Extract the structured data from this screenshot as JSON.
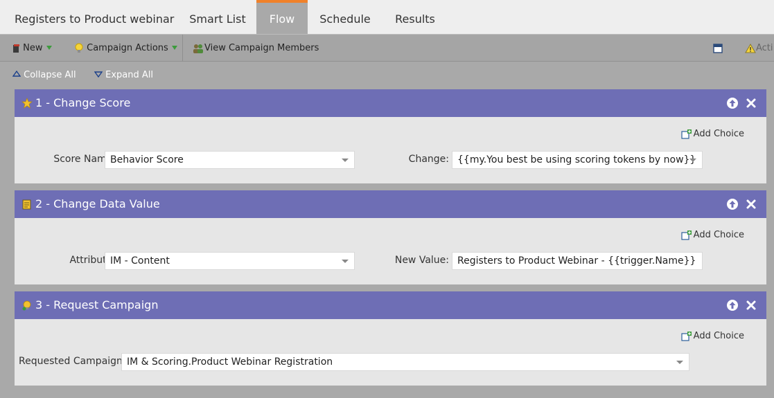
{
  "tabs": [
    {
      "label": "Registers to Product webinar",
      "active": false
    },
    {
      "label": "Smart List",
      "active": false
    },
    {
      "label": "Flow",
      "active": true
    },
    {
      "label": "Schedule",
      "active": false
    },
    {
      "label": "Results",
      "active": false
    }
  ],
  "toolbar": {
    "new_label": "New",
    "campaign_actions_label": "Campaign Actions",
    "view_members_label": "View Campaign Members",
    "right_text": "Acti"
  },
  "controls": {
    "collapse_all": "Collapse All",
    "expand_all": "Expand All"
  },
  "steps": [
    {
      "title": "1 - Change Score",
      "icon": "star-icon",
      "add_choice": "Add Choice",
      "field1_label": "Score Name:",
      "field1_value": "Behavior Score",
      "field2_label": "Change:",
      "field2_value": "{{my.You best be using scoring tokens by now}}"
    },
    {
      "title": "2 - Change Data Value",
      "icon": "data-value-icon",
      "add_choice": "Add Choice",
      "field1_label": "Attribute:",
      "field1_value": "IM - Content",
      "field2_label": "New Value:",
      "field2_value": "Registers to Product Webinar - {{trigger.Name}}"
    },
    {
      "title": "3 - Request Campaign",
      "icon": "campaign-icon",
      "add_choice": "Add Choice",
      "field1_label": "Requested Campaign:",
      "field1_value": "IM & Scoring.Product Webinar Registration"
    }
  ],
  "colors": {
    "step_header": "#6e6eb5",
    "active_tab": "#a9a9a9",
    "active_tab_accent": "#f0812a"
  }
}
